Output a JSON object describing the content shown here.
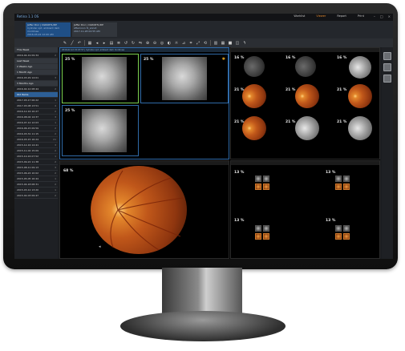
{
  "app": {
    "title": "Retina 1.1 OS"
  },
  "topnav": {
    "items": [
      "Worklist",
      "Viewer",
      "Report",
      "Print"
    ],
    "active": "Viewer"
  },
  "patients": [
    {
      "line1": "Jaffer Dior | CGR06TL/DP",
      "line2": "Cylinder opt. ambient dark montinee",
      "line3": "2016-03-22 12:00 AM"
    },
    {
      "line1": "Jaffer Dior | CGR06TL/DP",
      "line2": "Afternoon 3i_annot",
      "line3": "2017-11-28 04:55 AM"
    }
  ],
  "sidebar": {
    "rows": [
      {
        "label": "This Week",
        "count": "",
        "kind": "group"
      },
      {
        "label": "2016-04-19 09:34",
        "count": "2",
        "kind": "item"
      },
      {
        "label": "Last Week",
        "count": "",
        "kind": "group"
      },
      {
        "label": "2 Weeks Ago",
        "count": "",
        "kind": "group"
      },
      {
        "label": "1 Month Ago",
        "count": "",
        "kind": "group"
      },
      {
        "label": "2016-03-29 14:01",
        "count": "3",
        "kind": "item"
      },
      {
        "label": "3 Months Ago",
        "count": "",
        "kind": "group"
      },
      {
        "label": "2016-02-12 08:44",
        "count": "2",
        "kind": "item"
      },
      {
        "label": "Old Items",
        "count": "",
        "kind": "selected"
      },
      {
        "label": "2017-03-17 06:22",
        "count": "1",
        "kind": "item"
      },
      {
        "label": "2017-03-08 13:51",
        "count": "4",
        "kind": "item"
      },
      {
        "label": "2016-12-16 10:27",
        "count": "2",
        "kind": "item"
      },
      {
        "label": "2016-08-04 14:37",
        "count": "3",
        "kind": "item"
      },
      {
        "label": "2016-07-12 12:03",
        "count": "1",
        "kind": "item"
      },
      {
        "label": "2016-06-15 09:59",
        "count": "2",
        "kind": "item"
      },
      {
        "label": "2016-03-31 11:15",
        "count": "2",
        "kind": "item"
      },
      {
        "label": "2016-03-15 16:24",
        "count": "21",
        "kind": "item"
      },
      {
        "label": "2015-12-16 14:41",
        "count": "3",
        "kind": "item"
      },
      {
        "label": "2015-11-02 15:09",
        "count": "2",
        "kind": "item"
      },
      {
        "label": "2015-10-16 07:52",
        "count": "1",
        "kind": "item"
      },
      {
        "label": "2015-09-22 11:38",
        "count": "2",
        "kind": "item"
      },
      {
        "label": "2015-08-11 09:13",
        "count": "3",
        "kind": "item"
      },
      {
        "label": "2015-06-24 10:02",
        "count": "2",
        "kind": "item"
      },
      {
        "label": "2015-05-05 16:44",
        "count": "1",
        "kind": "item"
      },
      {
        "label": "2015-04-18 08:31",
        "count": "2",
        "kind": "item"
      },
      {
        "label": "2015-03-12 13:20",
        "count": "1",
        "kind": "item"
      },
      {
        "label": "2015-02-03 09:47",
        "count": "2",
        "kind": "item"
      }
    ]
  },
  "panes": {
    "top_left": {
      "header": "2016-02-12 15:07:57 | Cylinder opt. ambient dark montinee",
      "zoom": [
        "25 %",
        "25 %",
        "25 %"
      ]
    },
    "top_right": {
      "header": "",
      "zoom": [
        "16 %",
        "16 %",
        "16 %",
        "21 %",
        "21 %",
        "21 %",
        "21 %",
        "21 %",
        "21 %"
      ]
    },
    "bottom_left": {
      "zoom": "68 %"
    },
    "bottom_right": {
      "zoom": [
        "13 %",
        "13 %",
        "13 %",
        "13 %"
      ]
    }
  },
  "colors": {
    "accent": "#e58a2c",
    "selected_blue": "#2d5f96",
    "bezel": "#1a1a1a"
  }
}
